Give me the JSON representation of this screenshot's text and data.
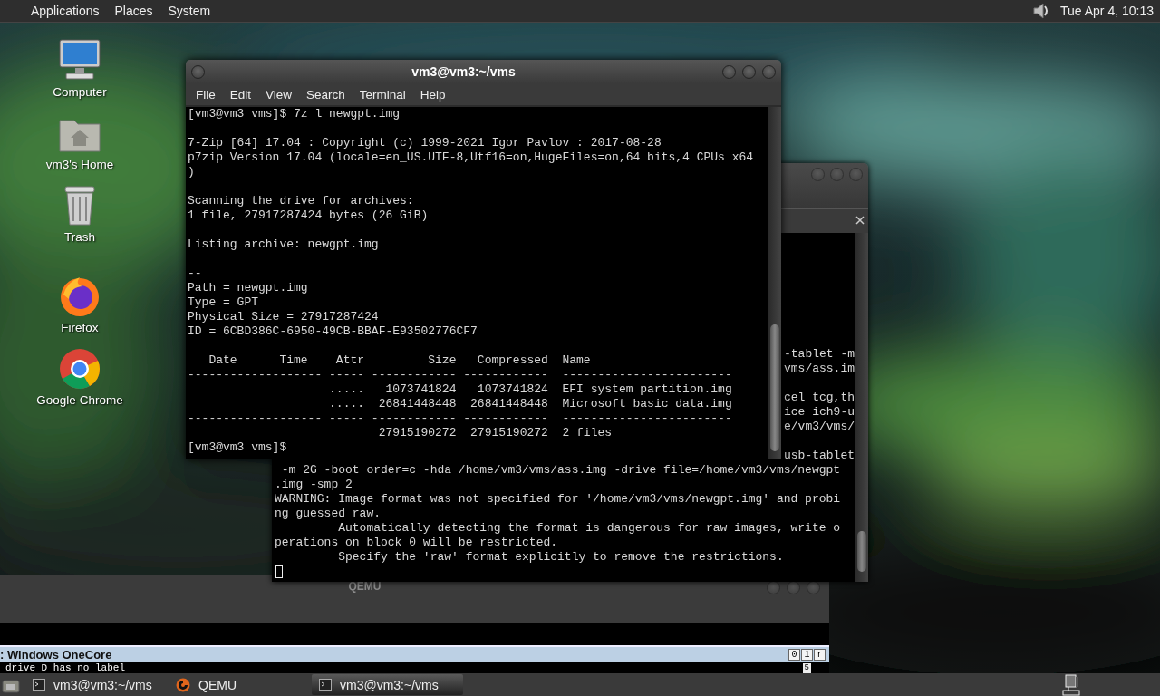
{
  "top_panel": {
    "menus": [
      "Applications",
      "Places",
      "System"
    ],
    "clock": "Tue Apr  4, 10:13"
  },
  "desktop_icons": [
    {
      "kind": "computer",
      "label": "Computer"
    },
    {
      "kind": "home",
      "label": "vm3's Home"
    },
    {
      "kind": "trash",
      "label": "Trash"
    },
    {
      "kind": "firefox",
      "label": "Firefox"
    },
    {
      "kind": "chrome",
      "label": "Google Chrome"
    }
  ],
  "qemu_window": {
    "title": "QEMU",
    "guest_title": ": Windows OneCore",
    "guest_buttons": [
      "0",
      "1",
      "r"
    ],
    "guest_line": "drive D has no label",
    "guest_counter": "5"
  },
  "back_terminal": {
    "fragment_blocks": [
      [
        "-tablet -m",
        "vms/ass.im"
      ],
      [
        "cel tcg,th",
        "ice ich9-u",
        "e/vm3/vms/"
      ],
      [
        "usb-tablet"
      ]
    ],
    "lines": [
      " -m 2G -boot order=c -hda /home/vm3/vms/ass.img -drive file=/home/vm3/vms/newgpt",
      ".img -smp 2",
      "WARNING: Image format was not specified for '/home/vm3/vms/newgpt.img' and probi",
      "ng guessed raw.",
      "         Automatically detecting the format is dangerous for raw images, write o",
      "perations on block 0 will be restricted.",
      "         Specify the 'raw' format explicitly to remove the restrictions."
    ]
  },
  "front_terminal": {
    "title": "vm3@vm3:~/vms",
    "menus": [
      "File",
      "Edit",
      "View",
      "Search",
      "Terminal",
      "Help"
    ],
    "blocks": [
      [
        "[vm3@vm3 vms]$ 7z l newgpt.img"
      ],
      [
        "7-Zip [64] 17.04 : Copyright (c) 1999-2021 Igor Pavlov : 2017-08-28",
        "p7zip Version 17.04 (locale=en_US.UTF-8,Utf16=on,HugeFiles=on,64 bits,4 CPUs x64",
        ")"
      ],
      [
        "Scanning the drive for archives:",
        "1 file, 27917287424 bytes (26 GiB)"
      ],
      [
        "Listing archive: newgpt.img"
      ],
      [
        "--",
        "Path = newgpt.img",
        "Type = GPT",
        "Physical Size = 27917287424",
        "ID = 6CBD386C-6950-49CB-BBAF-E93502776CF7"
      ],
      [
        "   Date      Time    Attr         Size   Compressed  Name",
        "------------------- ----- ------------ ------------  ------------------------",
        "                    .....   1073741824   1073741824  EFI system partition.img",
        "                    .....  26841448448  26841448448  Microsoft basic data.img",
        "------------------- ----- ------------ ------------  ------------------------",
        "                           27915190272  27915190272  2 files",
        "[vm3@vm3 vms]$"
      ]
    ]
  },
  "taskbar": {
    "items": [
      {
        "kind": "terminal",
        "label": "vm3@vm3:~/vms",
        "selected": false
      },
      {
        "kind": "qemu",
        "label": "QEMU",
        "selected": false
      },
      {
        "kind": "terminal",
        "label": "vm3@vm3:~/vms",
        "selected": true
      }
    ]
  }
}
